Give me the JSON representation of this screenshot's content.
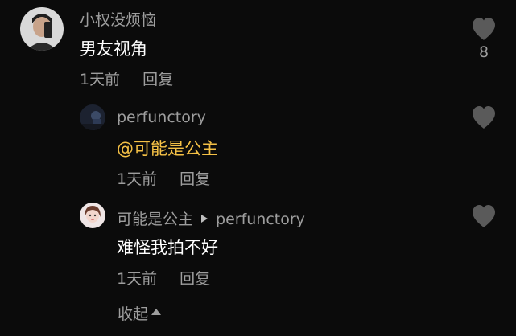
{
  "comments": [
    {
      "username": "小权没烦恼",
      "text": "男友视角",
      "time": "1天前",
      "reply_label": "回复",
      "likes": "8",
      "avatar_icon": "user-avatar-selfie"
    }
  ],
  "replies": [
    {
      "username": "perfunctory",
      "text": "@可能是公主",
      "time": "1天前",
      "reply_label": "回复",
      "avatar_icon": "user-avatar-dark"
    },
    {
      "username": "可能是公主",
      "reply_to": "perfunctory",
      "text": "难怪我拍不好",
      "time": "1天前",
      "reply_label": "回复",
      "avatar_icon": "user-avatar-girl"
    }
  ],
  "collapse_label": "收起",
  "colors": {
    "background": "#0b0b0b",
    "mention": "#f5c146",
    "secondary_text": "#9e9e9e",
    "like_icon": "#5a5a5a"
  }
}
